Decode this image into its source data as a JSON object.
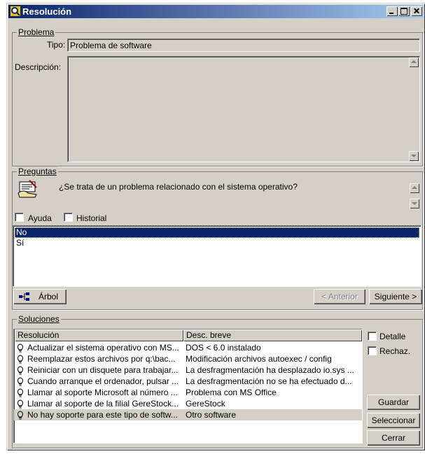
{
  "window": {
    "title": "Resolución"
  },
  "problema": {
    "legend": "Problema",
    "tipo_label": "Tipo:",
    "tipo_value": "Problema de software",
    "descripcion_label": "Descripción:",
    "descripcion_value": ""
  },
  "preguntas": {
    "legend": "Preguntas",
    "question": "¿Se trata de un problema relacionado con el sistema operativo?",
    "ayuda_label": "Ayuda",
    "historial_label": "Historial",
    "answers": [
      "No",
      "Sí"
    ],
    "selected_answer": "No",
    "arbol_label": "Árbol",
    "anterior_label": "< Anterior",
    "siguiente_label": "Siguiente >"
  },
  "soluciones": {
    "legend": "Soluciones",
    "columns": [
      "Resolución",
      "Desc. breve"
    ],
    "rows": [
      {
        "resolucion": "Actualizar el sistema operativo con MS...",
        "desc": "DOS < 6.0 instalado"
      },
      {
        "resolucion": "Reemplazar estos archivos por q:\\bac...",
        "desc": "Modificación archivos autoexec / config"
      },
      {
        "resolucion": "Reiniciar con un disquete para trabajar...",
        "desc": "La desfragmentación ha desplazado io.sys ..."
      },
      {
        "resolucion": "Cuando arranque el ordenador, pulsar ...",
        "desc": "La desfragmentación no se ha efectuado d..."
      },
      {
        "resolucion": "Llamar al soporte Microsoft al número ...",
        "desc": "Problema con MS Office"
      },
      {
        "resolucion": "Llamar al soporte de la filial GereStock...",
        "desc": "GereStock"
      },
      {
        "resolucion": "No hay soporte para este tipo de softw...",
        "desc": "Otro software"
      }
    ],
    "highlighted_row": 6,
    "detalle_label": "Detalle",
    "rechaz_label": "Rechaz.",
    "guardar_label": "Guardar",
    "seleccionar_label": "Seleccionar",
    "cerrar_label": "Cerrar"
  },
  "colors": {
    "title_start": "#0a246a",
    "title_end": "#a6caf0",
    "selection": "#0a246a",
    "face": "#d4d0c8"
  }
}
